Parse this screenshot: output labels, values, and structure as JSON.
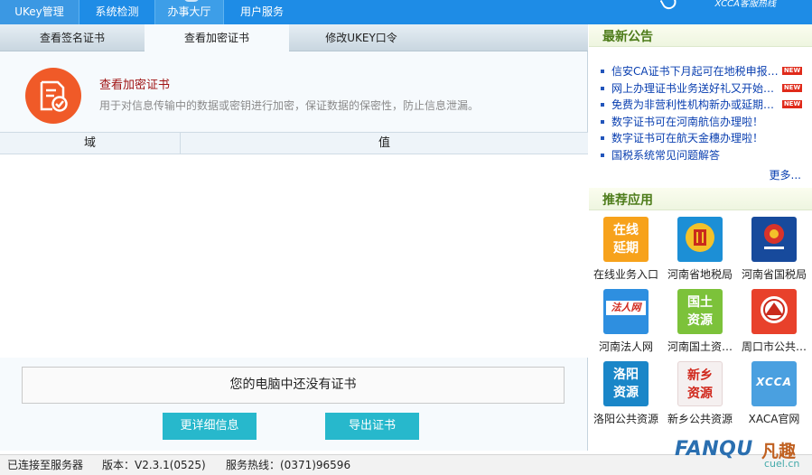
{
  "topnav": {
    "tabs": [
      {
        "label": "UKey管理"
      },
      {
        "label": "系统检测"
      },
      {
        "label": "办事大厅"
      },
      {
        "label": "用户服务"
      }
    ],
    "brand": "XCCA客服热线"
  },
  "subtabs": [
    {
      "label": "查看签名证书"
    },
    {
      "label": "查看加密证书"
    },
    {
      "label": "修改UKEY口令"
    }
  ],
  "cert": {
    "title": "查看加密证书",
    "desc": "用于对信息传输中的数据或密钥进行加密，保证数据的保密性，防止信息泄漏。"
  },
  "table": {
    "columns": [
      "域",
      "值"
    ]
  },
  "no_cert_message": "您的电脑中还没有证书",
  "buttons": {
    "details": "更详细信息",
    "export": "导出证书"
  },
  "status": {
    "connection": "已连接至服务器",
    "version": "版本：V2.3.1(0525)",
    "hotline": "服务热线：(0371)96596"
  },
  "announcements": {
    "title": "最新公告",
    "items": [
      {
        "text": "信安CA证书下月起可在地税申报…",
        "new": true
      },
      {
        "text": "网上办理证书业务送好礼又开始…",
        "new": true
      },
      {
        "text": "免费为非营利性机构新办或延期…",
        "new": true
      },
      {
        "text": "数字证书可在河南航信办理啦！",
        "new": false
      },
      {
        "text": "数字证书可在航天金穗办理啦！",
        "new": false
      },
      {
        "text": "国税系统常见问题解答",
        "new": false
      }
    ],
    "new_badge": "NEW",
    "more": "更多..."
  },
  "apps": {
    "title": "推荐应用",
    "items": [
      {
        "label": "在线业务入口",
        "tile": "在线\n延期",
        "color": "#f7a21b",
        "icon": "online-renewal-icon"
      },
      {
        "label": "河南省地税局",
        "tile": "",
        "color": "#1c8fd6",
        "icon": "local-tax-emblem-icon"
      },
      {
        "label": "河南省国税局",
        "tile": "",
        "color": "#174a9c",
        "icon": "national-tax-emblem-icon"
      },
      {
        "label": "河南法人网",
        "tile": "法人网",
        "color": "#2e8fe0",
        "icon": "legal-person-icon"
      },
      {
        "label": "河南国土资…",
        "tile": "国土\n资源",
        "color": "#7cc23a",
        "icon": "land-resources-icon"
      },
      {
        "label": "周口市公共…",
        "tile": "",
        "color": "#e8412b",
        "icon": "zhoukou-emblem-icon"
      },
      {
        "label": "洛阳公共资源",
        "tile": "洛阳\n资源",
        "color": "#1a86c8",
        "icon": "luoyang-resources-icon"
      },
      {
        "label": "新乡公共资源",
        "tile": "新乡\n资源",
        "color": "#f5f0f0",
        "icon": "xinxiang-resources-icon"
      },
      {
        "label": "XACA官网",
        "tile": "XCCA",
        "color": "#4aa0e0",
        "icon": "xaca-logo-icon"
      }
    ]
  },
  "watermark": {
    "text": "FANQU",
    "cn": "凡趣",
    "domain": "cuel.cn"
  }
}
